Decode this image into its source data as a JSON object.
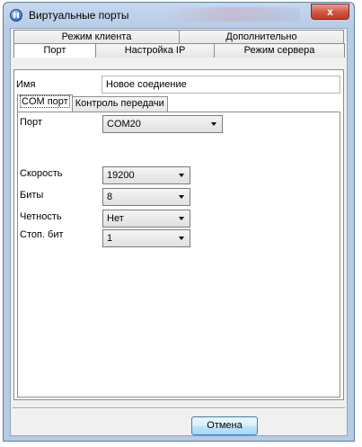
{
  "window": {
    "title": "Виртуальные порты",
    "close_label": "x"
  },
  "tabs": {
    "row_back": [
      "Режим клиента",
      "Дополнительно"
    ],
    "row_front": [
      "Порт",
      "Настройка IP",
      "Режим сервера"
    ]
  },
  "name_field": {
    "label": "Имя",
    "value": "Новое соедиение"
  },
  "subtabs": [
    "COM порт",
    "Контроль передачи"
  ],
  "port": {
    "label": "Порт",
    "value": "COM20"
  },
  "speed": {
    "label": "Скорость",
    "value": "19200"
  },
  "bits": {
    "label": "Биты",
    "value": "8"
  },
  "parity": {
    "label": "Четность",
    "value": "Нет"
  },
  "stop_bits": {
    "label": "Стоп. бит",
    "value": "1"
  },
  "buttons": {
    "cancel": "Отмена"
  }
}
